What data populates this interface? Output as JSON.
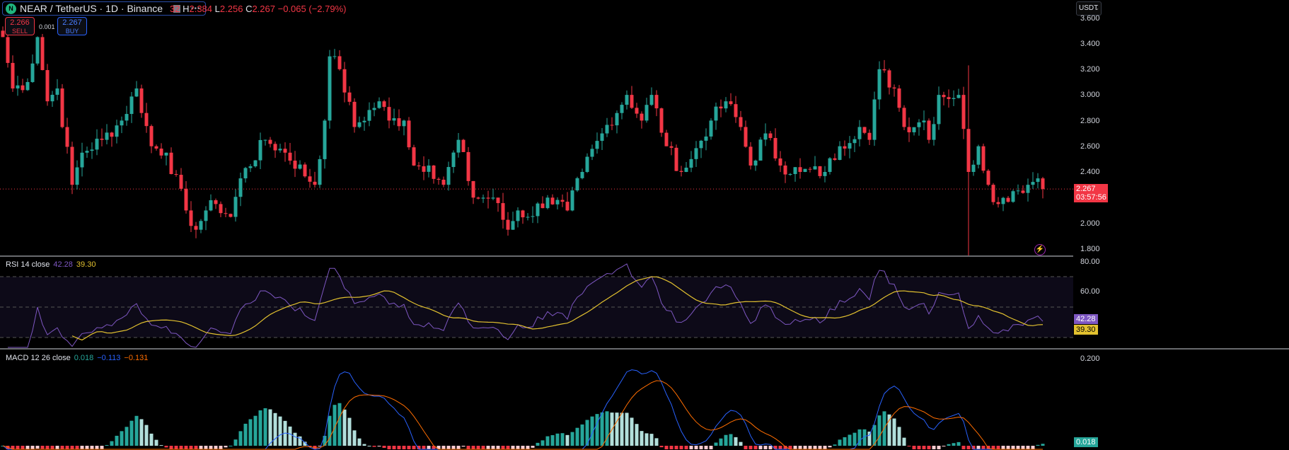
{
  "header": {
    "symbol": "NEAR / TetherUS · 1D · Binance",
    "logo_letter": "N",
    "more": "•••",
    "ohlc_prefix": "32",
    "h_label": "H",
    "h": "2.384",
    "l_label": "L",
    "l": "2.256",
    "c_label": "C",
    "c": "2.267",
    "change": "−0.065 (−2.79%)"
  },
  "trade": {
    "sell_price": "2.266",
    "sell_label": "SELL",
    "buy_price": "2.267",
    "buy_label": "BUY",
    "spread": "0.001"
  },
  "currency_selector": "USDT",
  "price_axis": {
    "labels": [
      "3.600",
      "3.400",
      "3.200",
      "3.000",
      "2.800",
      "2.600",
      "2.400",
      "2.000",
      "1.800"
    ],
    "last_price": "2.267",
    "countdown": "03:57:56"
  },
  "rsi": {
    "title": "RSI 14 close",
    "value": "42.28",
    "ma": "39.30",
    "axis": [
      "80.00",
      "60.00"
    ]
  },
  "macd": {
    "title": "MACD 12 26 close",
    "hist": "0.018",
    "macd": "−0.113",
    "signal": "−0.131",
    "axis": [
      "0.200"
    ],
    "hist_tag": "0.018"
  },
  "colors": {
    "up": "#26a69a",
    "down": "#f23645",
    "rsi": "#7e57c2",
    "rsi_ma": "#e2c12f",
    "macd": "#2962ff",
    "signal": "#ff6d00"
  },
  "chart_data": {
    "type": "candlestick",
    "interval": "1D",
    "price_range": [
      1.8,
      3.6
    ],
    "close_keypoints": [
      [
        0,
        3.45
      ],
      [
        2,
        3.05
      ],
      [
        5,
        3.1
      ],
      [
        7,
        3.45
      ],
      [
        9,
        2.95
      ],
      [
        11,
        3.05
      ],
      [
        14,
        2.3
      ],
      [
        16,
        2.55
      ],
      [
        20,
        2.65
      ],
      [
        24,
        2.8
      ],
      [
        27,
        3.05
      ],
      [
        30,
        2.6
      ],
      [
        33,
        2.55
      ],
      [
        37,
        2.1
      ],
      [
        39,
        1.95
      ],
      [
        41,
        2.1
      ],
      [
        43,
        2.15
      ],
      [
        46,
        2.05
      ],
      [
        48,
        2.35
      ],
      [
        53,
        2.65
      ],
      [
        57,
        2.55
      ],
      [
        63,
        2.3
      ],
      [
        65,
        2.8
      ],
      [
        66,
        3.3
      ],
      [
        68,
        3.2
      ],
      [
        71,
        2.75
      ],
      [
        76,
        2.95
      ],
      [
        78,
        2.8
      ],
      [
        81,
        2.8
      ],
      [
        83,
        2.45
      ],
      [
        86,
        2.45
      ],
      [
        89,
        2.3
      ],
      [
        92,
        2.65
      ],
      [
        95,
        2.2
      ],
      [
        99,
        2.2
      ],
      [
        102,
        1.95
      ],
      [
        104,
        2.1
      ],
      [
        106,
        2.05
      ],
      [
        110,
        2.2
      ],
      [
        114,
        2.1
      ],
      [
        117,
        2.4
      ],
      [
        121,
        2.7
      ],
      [
        126,
        3.0
      ],
      [
        129,
        2.8
      ],
      [
        131,
        3.0
      ],
      [
        134,
        2.6
      ],
      [
        137,
        2.4
      ],
      [
        139,
        2.5
      ],
      [
        143,
        2.8
      ],
      [
        146,
        2.95
      ],
      [
        149,
        2.75
      ],
      [
        151,
        2.45
      ],
      [
        154,
        2.7
      ],
      [
        157,
        2.45
      ],
      [
        161,
        2.4
      ],
      [
        166,
        2.4
      ],
      [
        169,
        2.6
      ],
      [
        173,
        2.75
      ],
      [
        175,
        2.65
      ],
      [
        177,
        3.2
      ],
      [
        180,
        3.05
      ],
      [
        182,
        2.75
      ],
      [
        186,
        2.8
      ],
      [
        187,
        2.65
      ],
      [
        189,
        3.0
      ],
      [
        193,
        3.0
      ],
      [
        195,
        2.4
      ],
      [
        197,
        2.6
      ],
      [
        199,
        2.3
      ],
      [
        201,
        2.15
      ],
      [
        204,
        2.25
      ],
      [
        207,
        2.3
      ],
      [
        209,
        2.35
      ],
      [
        210,
        2.267
      ]
    ]
  }
}
